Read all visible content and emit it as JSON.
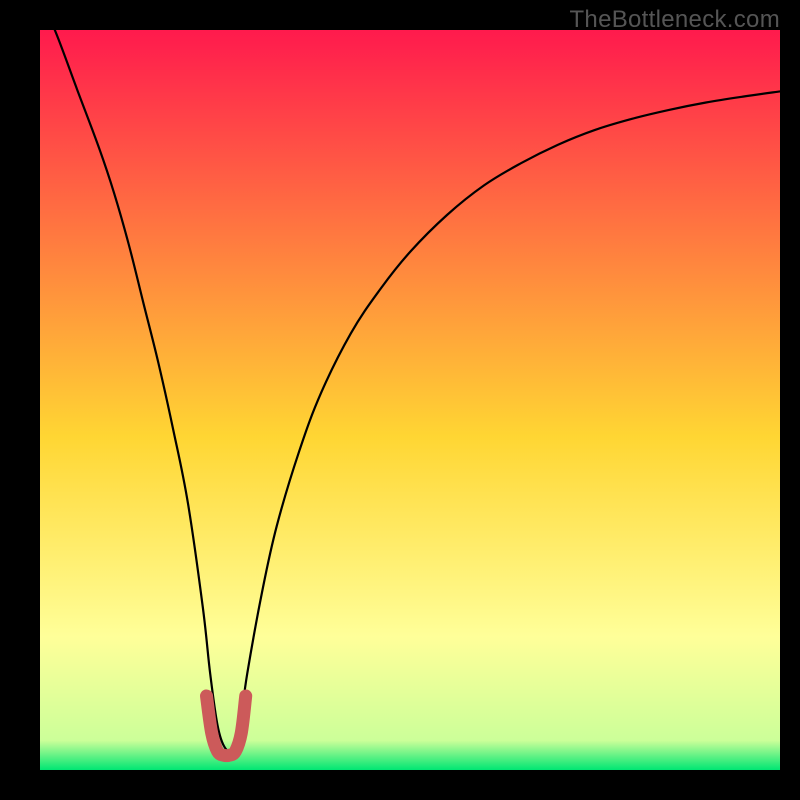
{
  "watermark": "TheBottleneck.com",
  "chart_data": {
    "type": "line",
    "title": "",
    "xlabel": "",
    "ylabel": "",
    "xlim": [
      0,
      100
    ],
    "ylim": [
      0,
      100
    ],
    "grid": false,
    "legend": false,
    "background_gradient": {
      "top_color": "#ff1a4d",
      "mid_color": "#ffd633",
      "near_bottom_color": "#ffff99",
      "bottom_color": "#00e673"
    },
    "series": [
      {
        "name": "bottleneck-curve",
        "color": "#000000",
        "x": [
          0,
          2,
          5,
          8,
          10,
          12,
          14,
          16,
          18,
          20,
          22,
          23,
          24,
          25,
          26,
          27,
          28,
          30,
          32,
          35,
          38,
          42,
          46,
          50,
          55,
          60,
          65,
          70,
          75,
          80,
          85,
          90,
          95,
          100
        ],
        "y": [
          104,
          100,
          92,
          84,
          78,
          71,
          63,
          55,
          46,
          36,
          22,
          13,
          6,
          3,
          3,
          6,
          13,
          24,
          33,
          43,
          51,
          59,
          65,
          70,
          75,
          79,
          82,
          84.5,
          86.5,
          88,
          89.2,
          90.2,
          91,
          91.7
        ]
      },
      {
        "name": "sweet-spot-marker",
        "color": "#cc5a5a",
        "x": [
          22.5,
          23.2,
          24.0,
          24.8,
          25.6,
          26.4,
          27.2,
          27.8
        ],
        "y": [
          10,
          5,
          2.5,
          2,
          2,
          2.5,
          5,
          10
        ]
      }
    ]
  }
}
